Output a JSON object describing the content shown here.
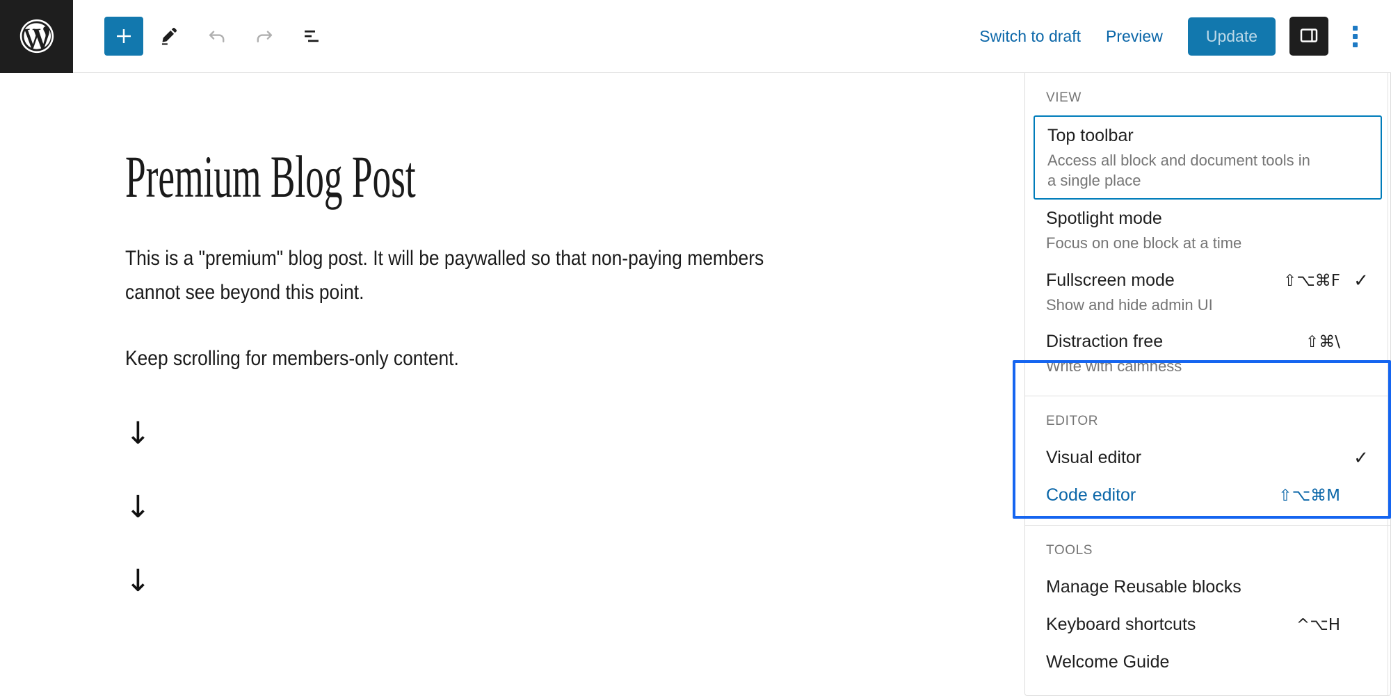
{
  "header": {
    "logo_icon": "wordpress-logo-icon",
    "tools": [
      {
        "name": "block-inserter-button",
        "icon": "plus-icon",
        "label": "Add block",
        "state": "primary"
      },
      {
        "name": "edit-tool-button",
        "icon": "pencil-icon",
        "label": "Edit",
        "state": "active"
      },
      {
        "name": "undo-button",
        "icon": "undo-arrow-icon",
        "label": "Undo",
        "state": "disabled"
      },
      {
        "name": "redo-button",
        "icon": "redo-arrow-icon",
        "label": "Redo",
        "state": "disabled"
      },
      {
        "name": "details-button",
        "icon": "list-view-icon",
        "label": "Details",
        "state": "default"
      }
    ],
    "switch_to_draft_label": "Switch to draft",
    "preview_label": "Preview",
    "update_label": "Update",
    "sidebar_toggle_icon": "settings-sidebar-icon",
    "kebab_icon": "vertical-dots-icon",
    "accent_blue": "#1278ae",
    "link_blue": "#0a66a8"
  },
  "post": {
    "title": "Premium Blog Post",
    "paragraphs": [
      "This is a \"premium\" blog post. It will be paywalled so that non-paying members cannot see beyond this point.",
      "Keep scrolling for members-only content."
    ],
    "arrows": [
      "↓",
      "↓",
      "↓"
    ]
  },
  "more_menu": {
    "groups": [
      {
        "label": "VIEW",
        "items": [
          {
            "title": "Top toolbar",
            "desc": "Access all block and document tools in a single place",
            "shortcut": "",
            "checked": false,
            "focused": true,
            "link": false
          },
          {
            "title": "Spotlight mode",
            "desc": "Focus on one block at a time",
            "shortcut": "",
            "checked": false,
            "focused": false,
            "link": false
          },
          {
            "title": "Fullscreen mode",
            "desc": "Show and hide admin UI",
            "shortcut": "⇧⌥⌘F",
            "checked": true,
            "focused": false,
            "link": false
          },
          {
            "title": "Distraction free",
            "desc": "Write with calmness",
            "shortcut": "⇧⌘\\",
            "checked": false,
            "focused": false,
            "link": false
          }
        ]
      },
      {
        "label": "EDITOR",
        "highlighted": true,
        "items": [
          {
            "title": "Visual editor",
            "desc": "",
            "shortcut": "",
            "checked": true,
            "focused": false,
            "link": false
          },
          {
            "title": "Code editor",
            "desc": "",
            "shortcut": "⇧⌥⌘M",
            "checked": false,
            "focused": false,
            "link": true
          }
        ]
      },
      {
        "label": "TOOLS",
        "items": [
          {
            "title": "Manage Reusable blocks",
            "desc": "",
            "shortcut": "",
            "checked": false,
            "focused": false,
            "link": false
          },
          {
            "title": "Keyboard shortcuts",
            "desc": "",
            "shortcut": "^⌥H",
            "checked": false,
            "focused": false,
            "link": false
          },
          {
            "title": "Welcome Guide",
            "desc": "",
            "shortcut": "",
            "checked": false,
            "focused": false,
            "link": false
          }
        ]
      }
    ],
    "annotation_color": "#1565f0"
  }
}
